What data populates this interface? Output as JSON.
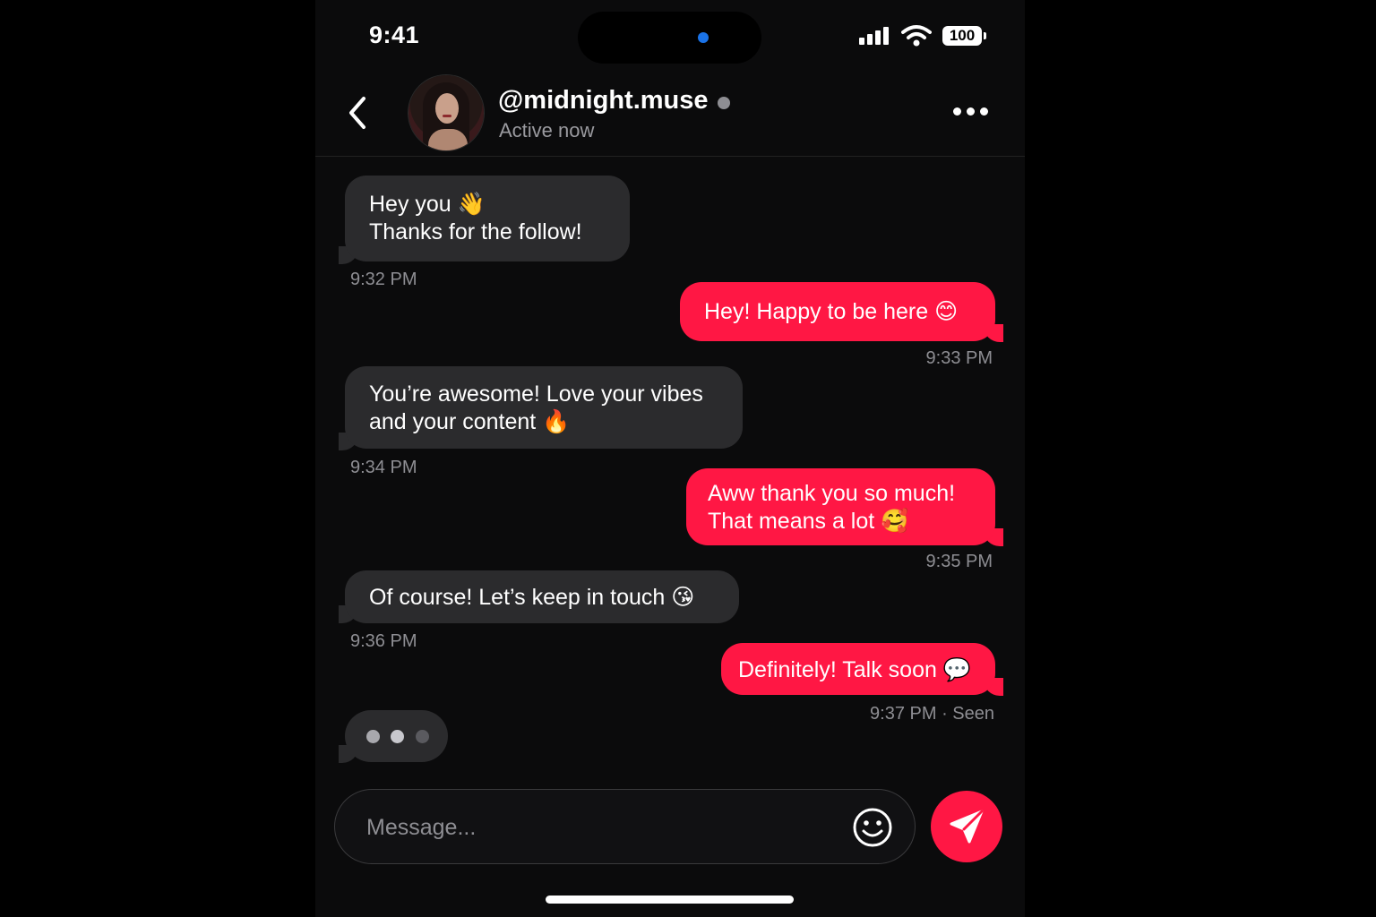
{
  "status_bar": {
    "time": "9:41",
    "battery": "100",
    "icons": [
      "signal-icon",
      "wifi-icon",
      "battery-icon"
    ]
  },
  "header": {
    "username": "@midnight.muse",
    "status": "Active now",
    "icons": [
      "back-chevron-icon",
      "more-dots-icon"
    ]
  },
  "messages": [
    {
      "from": "them",
      "lines": [
        "Hey you 👋",
        "Thanks for the follow!"
      ],
      "time": "9:32 PM"
    },
    {
      "from": "me",
      "lines": [
        "Hey! Happy to be here 😊"
      ],
      "time": "9:33 PM"
    },
    {
      "from": "them",
      "lines": [
        "You’re awesome! Love your vibes",
        "and your content 🔥"
      ],
      "time": "9:34 PM"
    },
    {
      "from": "me",
      "lines": [
        "Aww thank you so much!",
        "That means a lot 🥰"
      ],
      "time": "9:35 PM"
    },
    {
      "from": "them",
      "lines": [
        "Of course! Let’s keep in touch 😘"
      ],
      "time": "9:36 PM"
    },
    {
      "from": "me",
      "lines": [
        "Definitely! Talk soon 💬"
      ],
      "time": "9:37 PM · Seen"
    }
  ],
  "composer": {
    "placeholder": "Message...",
    "icons": [
      "emoji-icon",
      "send-icon"
    ]
  },
  "colors": {
    "accent": "#ff1744",
    "received_bubble": "#2b2b2d",
    "background": "#0b0b0c"
  }
}
